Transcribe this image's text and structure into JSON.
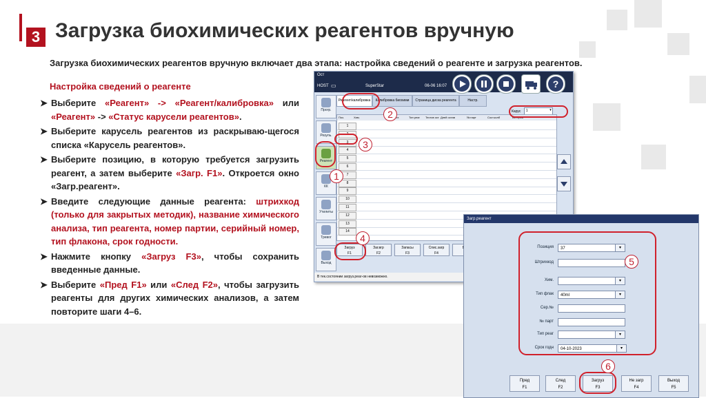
{
  "slide": {
    "number": "3",
    "title": "Загрузка биохимических реагентов вручную",
    "intro": "Загрузка биохимических реагентов вручную включает два этапа: настройка сведений о реагенте и загрузка реагентов.",
    "section_title": "Настройка сведений о реагенте"
  },
  "bullets": [
    {
      "parts": [
        {
          "t": "Выберите ",
          "red": false
        },
        {
          "t": "«Реагент» -> «Реагент/калибровка»",
          "red": true
        },
        {
          "t": " или ",
          "red": false
        },
        {
          "t": "«Реагент»",
          "red": true
        },
        {
          "t": " -> ",
          "red": false
        },
        {
          "t": "«Статус карусели реагентов»",
          "red": true
        },
        {
          "t": ".",
          "red": false
        }
      ]
    },
    {
      "parts": [
        {
          "t": "Выберите карусель реагентов из раскрываю-щегося списка «Карусель реагентов».",
          "red": false
        }
      ]
    },
    {
      "parts": [
        {
          "t": "Выберите позицию, в которую требуется загрузить реагент, а затем выберите ",
          "red": false
        },
        {
          "t": "«Загр. F1»",
          "red": true
        },
        {
          "t": ". Откроется окно «Загр.реагент».",
          "red": false
        }
      ]
    },
    {
      "parts": [
        {
          "t": "Введите следующие данные реагента: ",
          "red": false
        },
        {
          "t": "штрихкод (только для закрытых методик), название химического анализа, тип реагента, номер партии, серийный номер, тип флакона, срок годности.",
          "red": true
        }
      ]
    },
    {
      "parts": [
        {
          "t": "Нажмите кнопку ",
          "red": false
        },
        {
          "t": "«Загруз F3»",
          "red": true
        },
        {
          "t": ", чтобы сохранить введенные данные.",
          "red": false
        }
      ]
    },
    {
      "parts": [
        {
          "t": "Выберите ",
          "red": false
        },
        {
          "t": "«Пред F1»",
          "red": true
        },
        {
          "t": " или ",
          "red": false
        },
        {
          "t": "«След F2»",
          "red": true
        },
        {
          "t": ", чтобы загрузить реагенты для других химических анализов, а затем повторите шаги 4–6.",
          "red": false
        }
      ]
    }
  ],
  "screen": {
    "top_left": "Ост",
    "host": "HOST",
    "user": "SuperStar",
    "time": "06-06 16:07",
    "side_buttons": [
      "Прогр.",
      "Резуль.",
      "Реагент",
      "КК",
      "Утилиты",
      "Тревог",
      "Выход"
    ],
    "tabs": [
      "Реагент/калибровка",
      "Калибровка биохими",
      "Страница диска реагента",
      "Настр."
    ],
    "carousel_label": "Карус",
    "carousel_value": "1",
    "columns": [
      "Поз.",
      "Хим.",
      "Колич. ост.",
      "Тип реаг",
      "Тестов ост.",
      "Дней остав",
      "№ парт",
      "Сост.колб",
      "Вст.прив"
    ],
    "positions": [
      "1",
      "2",
      "3",
      "4",
      "5",
      "6",
      "7",
      "8",
      "9",
      "10",
      "11",
      "12",
      "13",
      "14"
    ],
    "function_buttons": [
      {
        "l1": "Загруз",
        "l2": "F1"
      },
      {
        "l1": "Заг.вгр",
        "l2": "F2"
      },
      {
        "l1": "Запасы",
        "l2": "F3"
      },
      {
        "l1": "Спис.загр",
        "l2": "F4"
      },
      {
        "l1": "Все",
        "l2": "F5"
      }
    ],
    "status": "В тек.состоянии загруз.реаг-ов невозможно."
  },
  "dialog": {
    "title": "Загр.реагент",
    "fields": [
      {
        "label": "Позиция",
        "value": "37",
        "dropdown": true
      },
      {
        "label": "Штрихкод",
        "value": "",
        "dropdown": false
      },
      {
        "label": "Хим.",
        "value": "",
        "dropdown": true
      },
      {
        "label": "Тип флак",
        "value": "40ml",
        "dropdown": true
      },
      {
        "label": "Сер.№",
        "value": "",
        "dropdown": false
      },
      {
        "label": "№ парт",
        "value": "",
        "dropdown": false
      },
      {
        "label": "Тип реаг",
        "value": "",
        "dropdown": true
      },
      {
        "label": "Срок годн",
        "value": "04-10-2023",
        "dropdown": true
      }
    ],
    "buttons": [
      {
        "l1": "Пред",
        "l2": "F1"
      },
      {
        "l1": "След",
        "l2": "F2"
      },
      {
        "l1": "Загруз",
        "l2": "F3"
      },
      {
        "l1": "Не загр",
        "l2": "F4"
      },
      {
        "l1": "Выход",
        "l2": "F5"
      }
    ]
  },
  "markers": [
    "1",
    "2",
    "3",
    "4",
    "5",
    "6"
  ]
}
